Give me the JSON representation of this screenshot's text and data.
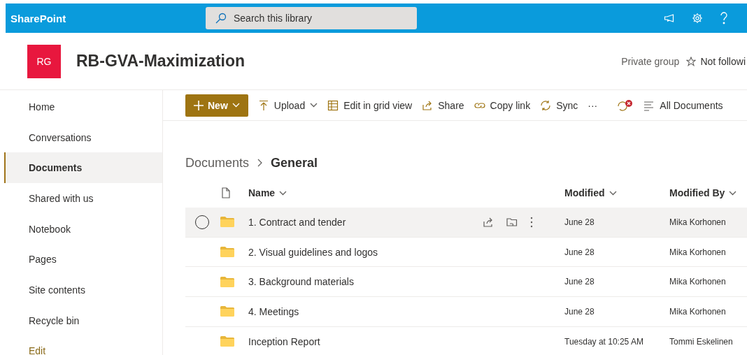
{
  "suite_bar": {
    "app_name": "SharePoint",
    "search": {
      "placeholder": "Search this library"
    }
  },
  "site_header": {
    "logo_initials": "RG",
    "title": "RB-GVA-Maximization",
    "privacy": "Private group",
    "follow": "Not followi"
  },
  "sidebar": {
    "items": [
      {
        "label": "Home",
        "selected": false
      },
      {
        "label": "Conversations",
        "selected": false
      },
      {
        "label": "Documents",
        "selected": true
      },
      {
        "label": "Shared with us",
        "selected": false
      },
      {
        "label": "Notebook",
        "selected": false
      },
      {
        "label": "Pages",
        "selected": false
      },
      {
        "label": "Site contents",
        "selected": false
      },
      {
        "label": "Recycle bin",
        "selected": false
      },
      {
        "label": "Edit",
        "selected": false,
        "kind": "link"
      }
    ]
  },
  "command_bar": {
    "new_button": "New",
    "commands": [
      {
        "kind": "upload",
        "label": "Upload",
        "dropdown": true
      },
      {
        "kind": "grid",
        "label": "Edit in grid view",
        "dropdown": false
      },
      {
        "kind": "share",
        "label": "Share",
        "dropdown": false
      },
      {
        "kind": "link",
        "label": "Copy link",
        "dropdown": false
      },
      {
        "kind": "sync",
        "label": "Sync",
        "dropdown": false
      }
    ],
    "more": "···",
    "view": "All Documents"
  },
  "breadcrumb": [
    {
      "label": "Documents",
      "current": false
    },
    {
      "label": "General",
      "current": true
    }
  ],
  "table": {
    "columns": [
      {
        "label": "Name"
      },
      {
        "label": "Modified"
      },
      {
        "label": "Modified By"
      }
    ],
    "rows": [
      {
        "name": "1. Contract and tender",
        "modified": "June 28",
        "modified_by": "Mika Korhonen",
        "hovered": true
      },
      {
        "name": "2. Visual guidelines and logos",
        "modified": "June 28",
        "modified_by": "Mika Korhonen",
        "hovered": false
      },
      {
        "name": "3. Background materials",
        "modified": "June 28",
        "modified_by": "Mika Korhonen",
        "hovered": false
      },
      {
        "name": "4. Meetings",
        "modified": "June 28",
        "modified_by": "Mika Korhonen",
        "hovered": false
      },
      {
        "name": "Inception Report",
        "modified": "Tuesday at 10:25 AM",
        "modified_by": "Tommi Eskelinen",
        "hovered": false
      }
    ]
  }
}
